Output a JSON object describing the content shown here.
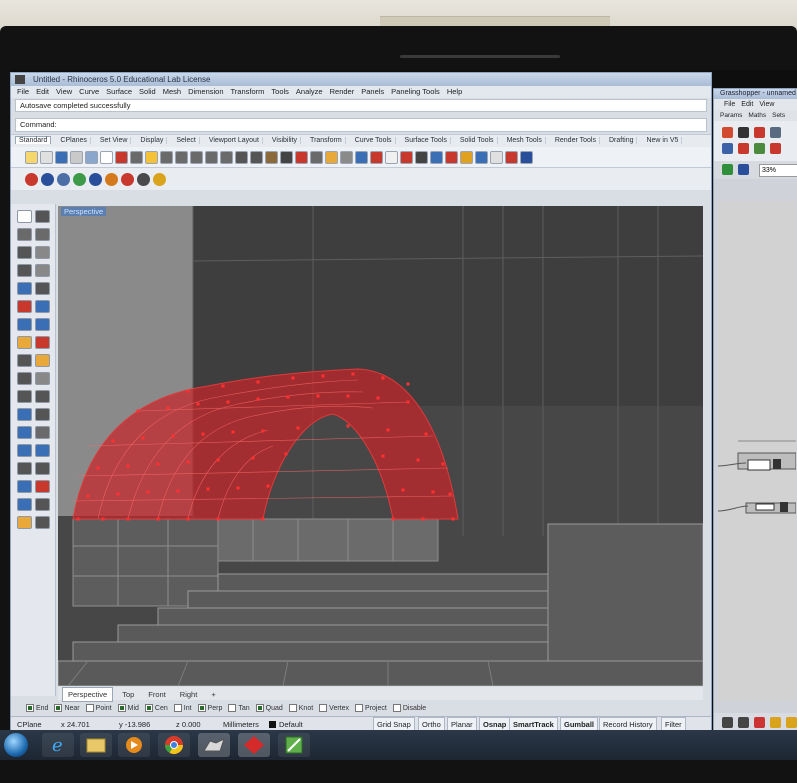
{
  "rhino": {
    "title": "Untitled - Rhinoceros 5.0 Educational Lab License",
    "menus": [
      "File",
      "Edit",
      "View",
      "Curve",
      "Surface",
      "Solid",
      "Mesh",
      "Dimension",
      "Transform",
      "Tools",
      "Analyze",
      "Render",
      "Panels",
      "Paneling Tools",
      "Help"
    ],
    "command_history": "Autosave completed successfully",
    "command_prompt": "Command:",
    "tabs": [
      "Standard",
      "CPlanes",
      "Set View",
      "Display",
      "Select",
      "Viewport Layout",
      "Visibility",
      "Transform",
      "Curve Tools",
      "Surface Tools",
      "Solid Tools",
      "Mesh Tools",
      "Render Tools",
      "Drafting",
      "New in V5"
    ],
    "viewport_label": "Perspective",
    "view_tabs": [
      "Perspective",
      "Top",
      "Front",
      "Right"
    ],
    "view_tab_add": "+",
    "osnaps": [
      {
        "label": "End",
        "checked": true
      },
      {
        "label": "Near",
        "checked": true
      },
      {
        "label": "Point",
        "checked": false
      },
      {
        "label": "Mid",
        "checked": true
      },
      {
        "label": "Cen",
        "checked": true
      },
      {
        "label": "Int",
        "checked": false
      },
      {
        "label": "Perp",
        "checked": true
      },
      {
        "label": "Tan",
        "checked": false
      },
      {
        "label": "Quad",
        "checked": true
      },
      {
        "label": "Knot",
        "checked": false
      },
      {
        "label": "Vertex",
        "checked": false
      },
      {
        "label": "Project",
        "checked": false
      },
      {
        "label": "Disable",
        "checked": false
      }
    ],
    "status": {
      "cplane": "CPlane",
      "x": "x 24.701",
      "y": "y -13.986",
      "z": "z 0.000",
      "units": "Millimeters",
      "layer": "Default",
      "grid_snap": "Grid Snap",
      "ortho": "Ortho",
      "planar": "Planar",
      "osnap": "Osnap",
      "smarttrack": "SmartTrack",
      "gumball": "Gumball",
      "record_history": "Record History",
      "filter": "Filter"
    },
    "accent_color": "#c8262a"
  },
  "grasshopper": {
    "title": "Grasshopper - unnamed",
    "menus": [
      "File",
      "Edit",
      "View"
    ],
    "tabs": [
      "Params",
      "Maths",
      "Sets"
    ],
    "zoom": "33%"
  }
}
